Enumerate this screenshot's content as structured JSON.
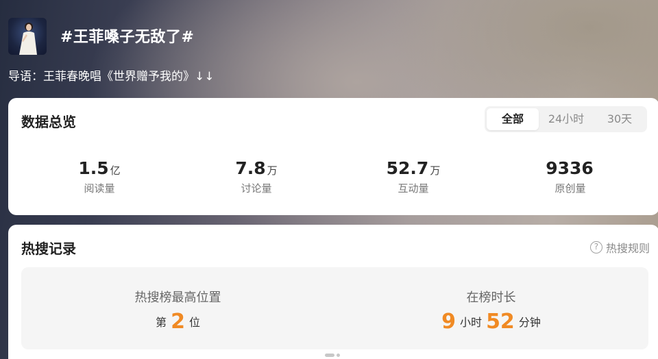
{
  "topic": {
    "title": "#王菲嗓子无敌了#",
    "intro": "导语：王菲春晚唱《世界赠予我的》↓↓"
  },
  "overview": {
    "title": "数据总览",
    "tabs": [
      "全部",
      "24小时",
      "30天"
    ],
    "active_tab": "全部",
    "stats": [
      {
        "value": "1.5",
        "unit": "亿",
        "label": "阅读量"
      },
      {
        "value": "7.8",
        "unit": "万",
        "label": "讨论量"
      },
      {
        "value": "52.7",
        "unit": "万",
        "label": "互动量"
      },
      {
        "value": "9336",
        "unit": "",
        "label": "原创量"
      }
    ]
  },
  "hot_search": {
    "title": "热搜记录",
    "rules_label": "热搜规则",
    "highest_position": {
      "label": "热搜榜最高位置",
      "prefix": "第",
      "value": "2",
      "suffix": "位"
    },
    "duration": {
      "label": "在榜时长",
      "hours": "9",
      "hours_unit": "小时",
      "minutes": "52",
      "minutes_unit": "分钟"
    }
  },
  "colors": {
    "accent_orange": "#f08a24",
    "card_bg": "#ffffff",
    "muted_text": "#777777"
  },
  "icons": {
    "help": "question-circle-icon",
    "avatar": "topic-cover-image"
  }
}
